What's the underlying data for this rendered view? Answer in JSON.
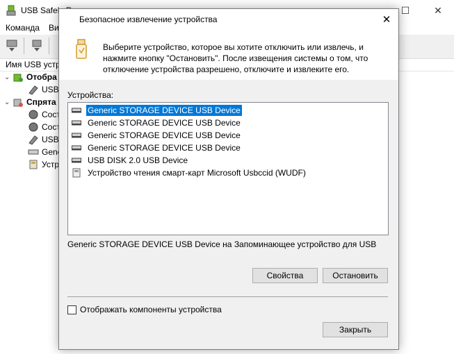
{
  "main_window": {
    "title": "USB Safely R",
    "menu": [
      "Команда",
      "Ви"
    ],
    "tree_header": "Имя USB устрой",
    "tree": [
      {
        "label": "Отобра",
        "bold": true,
        "expander": "❯"
      },
      {
        "label": "USB",
        "bold": false,
        "expander": ""
      },
      {
        "label": "Спрята",
        "bold": true,
        "expander": "❯"
      },
      {
        "label": "Сост",
        "bold": false,
        "expander": ""
      },
      {
        "label": "Сост",
        "bold": false,
        "expander": ""
      },
      {
        "label": "USB",
        "bold": false,
        "expander": ""
      },
      {
        "label": "Gene",
        "bold": false,
        "expander": ""
      },
      {
        "label": "Устр",
        "bold": false,
        "expander": ""
      }
    ]
  },
  "dialog": {
    "title": "Безопасное извлечение устройства",
    "description": [
      "Выберите устройство, которое вы хотите отключить или извлечь, и",
      "нажмите кнопку \"Остановить\". После извещения системы о том, что",
      "отключение устройства разрешено, отключите и извлеките его."
    ],
    "devices_label": "Устройства:",
    "devices": [
      {
        "name": "Generic STORAGE DEVICE USB Device",
        "icon": "drive-icon",
        "selected": true
      },
      {
        "name": "Generic STORAGE DEVICE USB Device",
        "icon": "drive-icon",
        "selected": false
      },
      {
        "name": "Generic STORAGE DEVICE USB Device",
        "icon": "drive-icon",
        "selected": false
      },
      {
        "name": "Generic STORAGE DEVICE USB Device",
        "icon": "drive-icon",
        "selected": false
      },
      {
        "name": "USB DISK 2.0 USB Device",
        "icon": "drive-icon",
        "selected": false
      },
      {
        "name": "Устройство чтения смарт-карт Microsoft Usbccid (WUDF)",
        "icon": "smartcard-reader-icon",
        "selected": false
      }
    ],
    "status_text": "Generic STORAGE DEVICE USB Device на Запоминающее устройство для USB",
    "properties_button": "Свойства",
    "stop_button": "Остановить",
    "show_components_label": "Отображать компоненты устройства",
    "show_components_checked": false,
    "close_button": "Закрыть"
  },
  "colors": {
    "selection": "#0078d7",
    "dialog_bg": "#f0f0f0",
    "button_bg": "#e1e1e1"
  }
}
